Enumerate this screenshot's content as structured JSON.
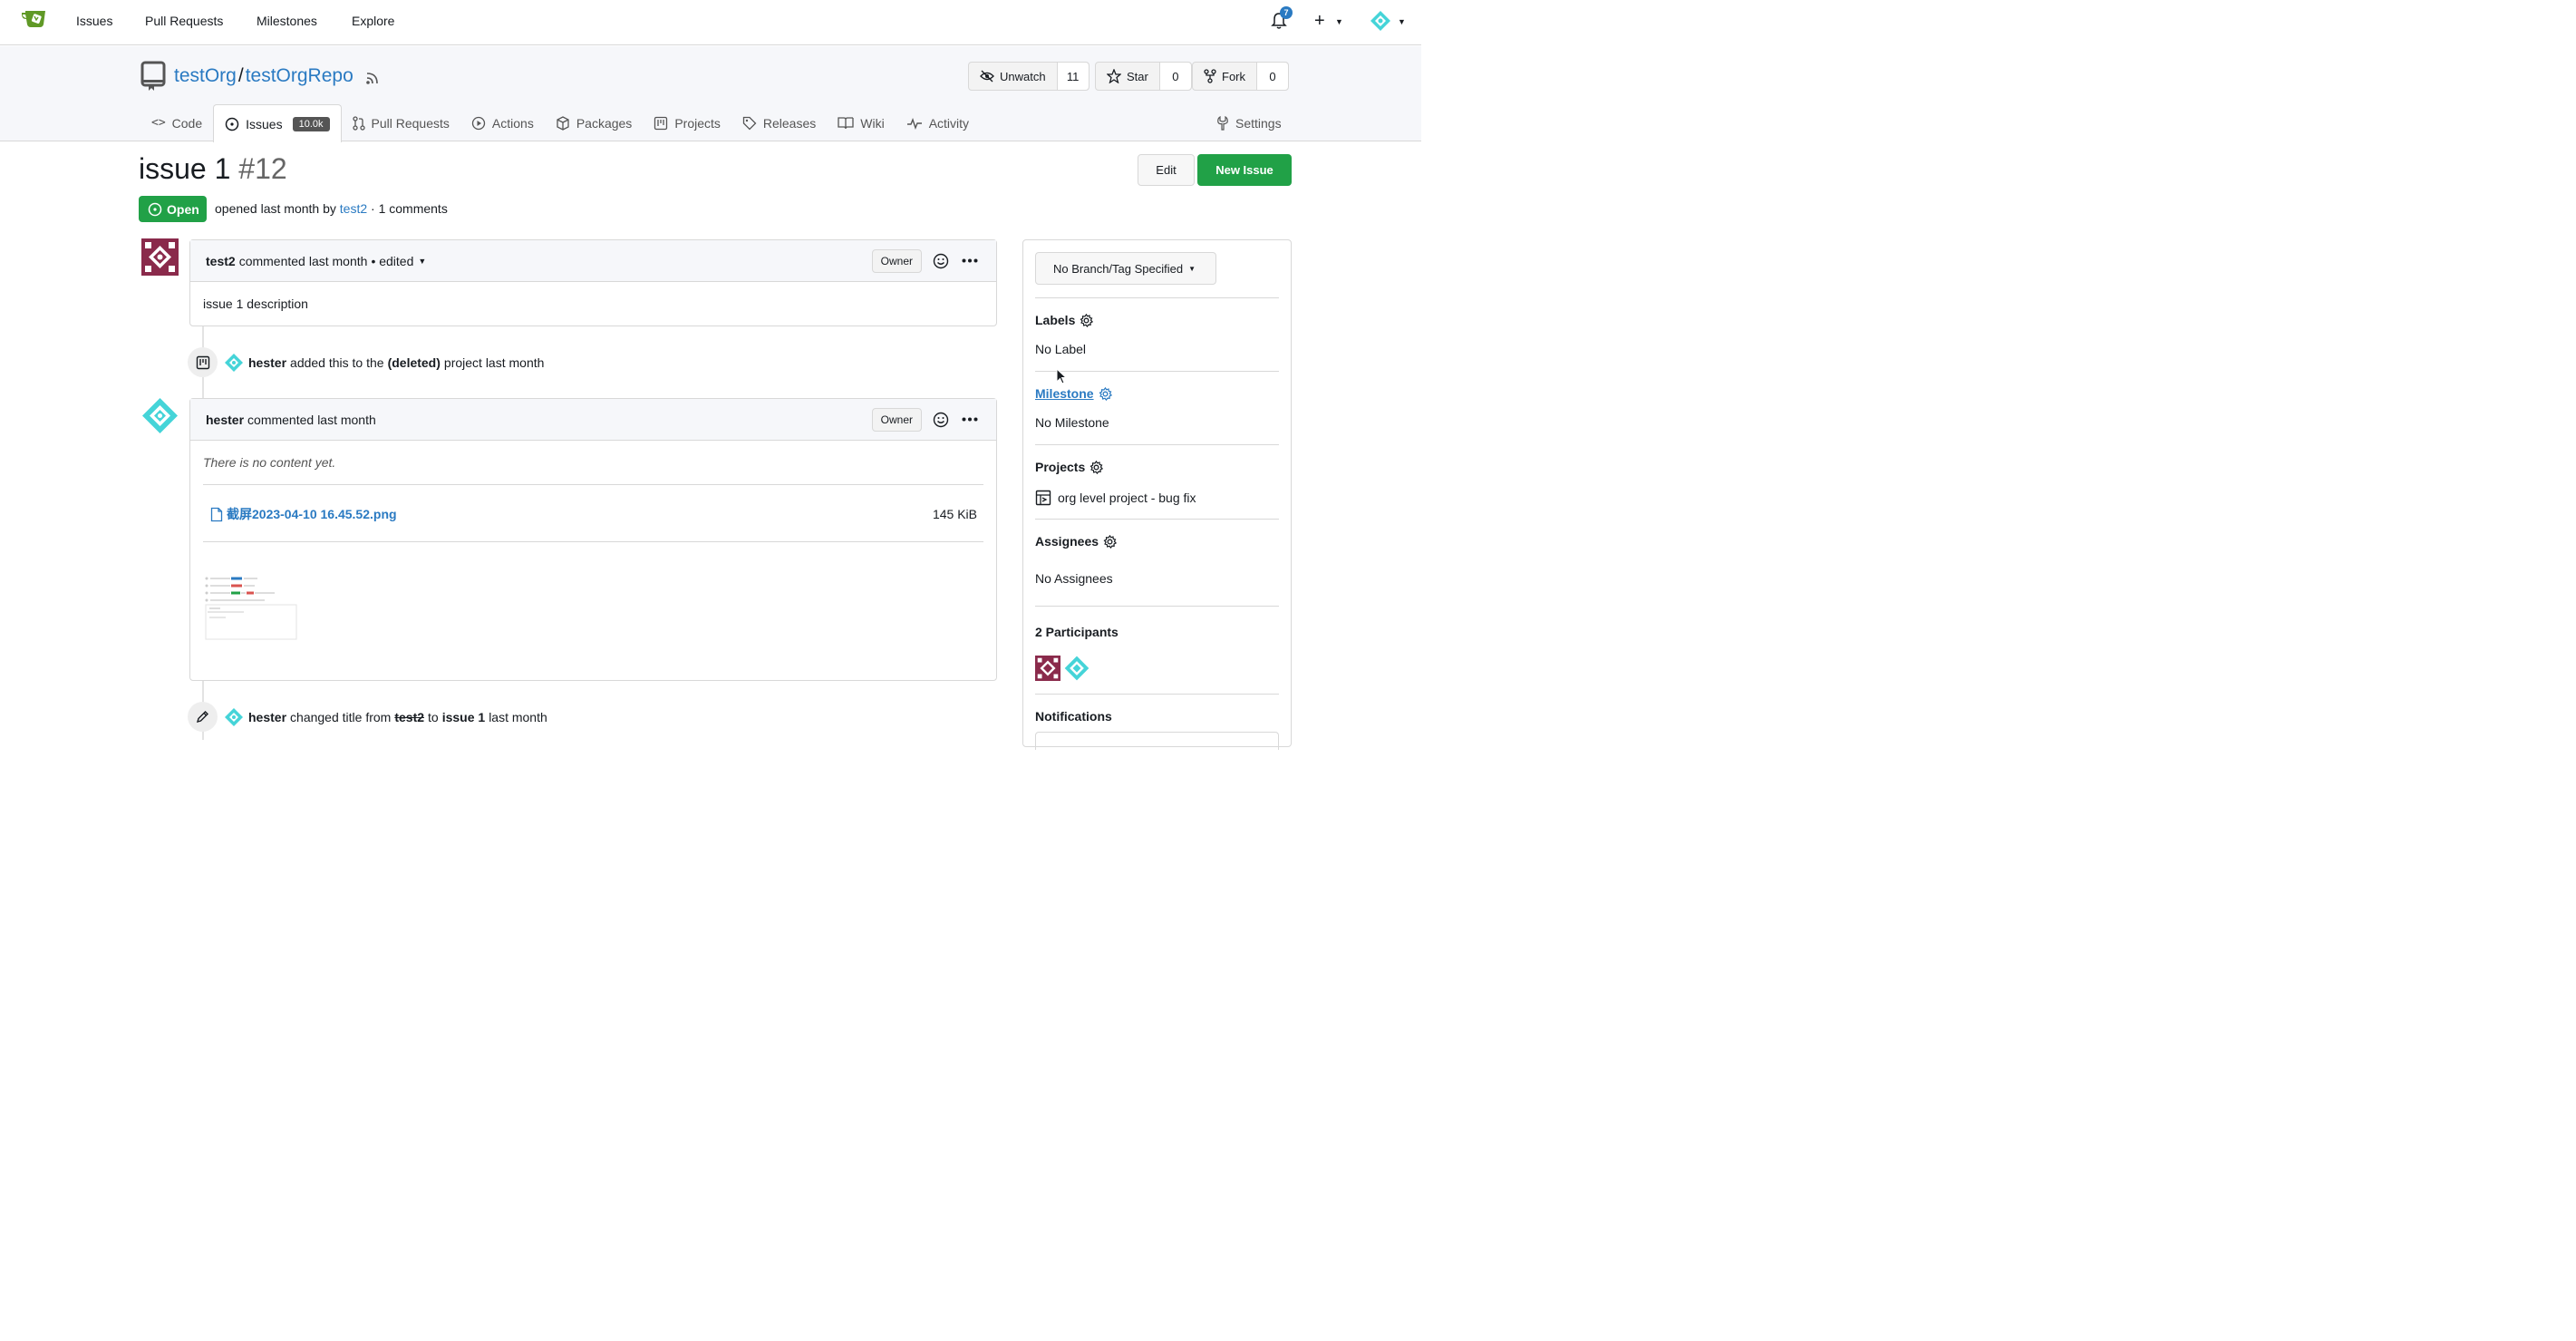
{
  "nav": {
    "links": [
      "Issues",
      "Pull Requests",
      "Milestones",
      "Explore"
    ],
    "notification_count": "7"
  },
  "repo": {
    "owner": "testOrg",
    "separator": "/",
    "name": "testOrgRepo",
    "watch": {
      "label": "Unwatch",
      "count": "11"
    },
    "star": {
      "label": "Star",
      "count": "0"
    },
    "fork": {
      "label": "Fork",
      "count": "0"
    }
  },
  "tabs": [
    {
      "label": "Code",
      "icon": "code-icon"
    },
    {
      "label": "Issues",
      "icon": "issue-icon",
      "count": "10.0k",
      "active": true
    },
    {
      "label": "Pull Requests",
      "icon": "pull-request-icon"
    },
    {
      "label": "Actions",
      "icon": "play-icon"
    },
    {
      "label": "Packages",
      "icon": "package-icon"
    },
    {
      "label": "Projects",
      "icon": "project-icon"
    },
    {
      "label": "Releases",
      "icon": "tag-icon"
    },
    {
      "label": "Wiki",
      "icon": "book-icon"
    },
    {
      "label": "Activity",
      "icon": "pulse-icon"
    }
  ],
  "settings_tab": "Settings",
  "issue": {
    "title": "issue 1",
    "index": "#12",
    "state": "Open",
    "meta_prefix": "opened last month by",
    "author": "test2",
    "meta_suffix": "· 1 comments",
    "edit_label": "Edit",
    "new_issue_label": "New Issue"
  },
  "comments": [
    {
      "author": "test2",
      "action": "commented",
      "time": "last month",
      "edited": "• edited",
      "role": "Owner",
      "body": "issue 1 description"
    },
    {
      "author": "hester",
      "action": "commented",
      "time": "last month",
      "role": "Owner",
      "body": "There is no content yet.",
      "attachment": {
        "name": "截屏2023-04-10 16.45.52.png",
        "size": "145 KiB"
      }
    }
  ],
  "events": [
    {
      "user": "hester",
      "text_a": "added this to the",
      "bold": "(deleted)",
      "text_b": "project last month"
    },
    {
      "user": "hester",
      "text_a": "changed title from",
      "old": "test2",
      "text_mid": "to",
      "new": "issue 1",
      "text_b": "last month"
    }
  ],
  "sidebar": {
    "branch": "No Branch/Tag Specified",
    "labels_title": "Labels",
    "labels_value": "No Label",
    "milestone_title": "Milestone",
    "milestone_value": "No Milestone",
    "projects_title": "Projects",
    "project_name": "org level project - bug fix",
    "assignees_title": "Assignees",
    "assignees_value": "No Assignees",
    "participants_title": "2 Participants",
    "notifications_title": "Notifications"
  },
  "colors": {
    "accent": "#2a7ac2",
    "green": "#21a147",
    "avatar_red": "#8a2a4b",
    "avatar_teal": "#45d4d8"
  }
}
